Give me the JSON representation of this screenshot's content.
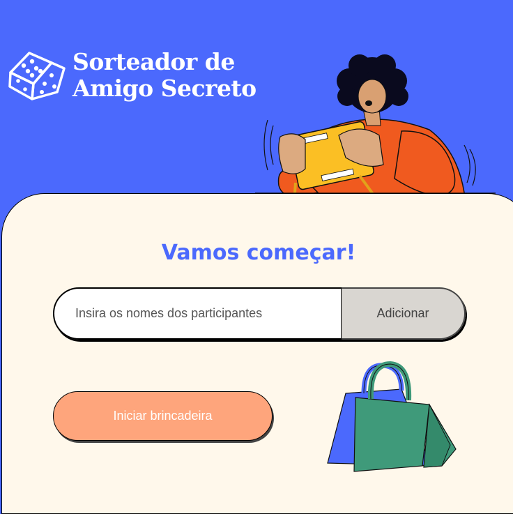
{
  "header": {
    "brand_line1": "Sorteador de",
    "brand_line2": "Amigo Secreto",
    "logo_icon": "dice-icon",
    "illustration": "person-holding-tablet"
  },
  "main": {
    "title": "Vamos começar!",
    "name_input": {
      "value": "",
      "placeholder": "Insira os nomes dos participantes"
    },
    "add_label": "Adicionar",
    "start_label": "Iniciar brincadeira",
    "illustration": "shopping-bags"
  },
  "colors": {
    "primary": "#4b69fd",
    "card_background": "#fff8eb",
    "start_button": "#fea57c",
    "add_button": "#d9d6d1",
    "bag_green": "#3f9a7a"
  }
}
